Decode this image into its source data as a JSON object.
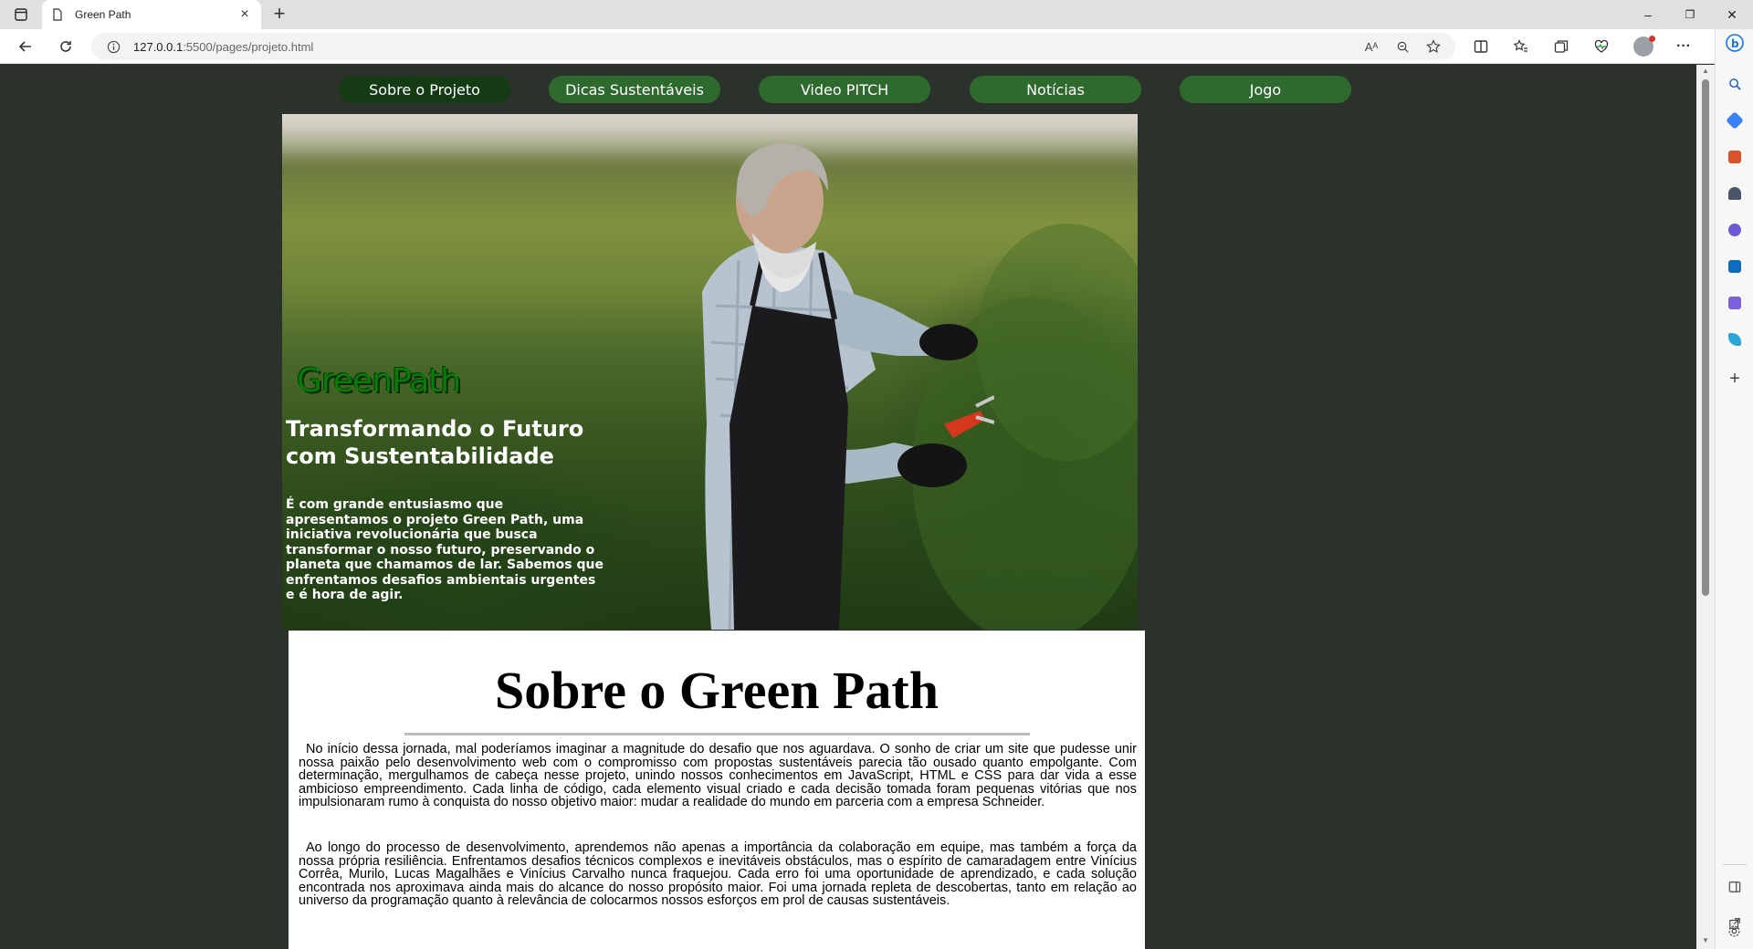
{
  "browser": {
    "tab_title": "Green Path",
    "tab_close": "×",
    "new_tab": "+",
    "url_host": "127.0.0.1",
    "url_path": ":5500/pages/projeto.html",
    "read_aloud": "Aᴬ",
    "more": "···",
    "win_minimize": "–",
    "win_restore": "❐",
    "win_close": "✕"
  },
  "nav": {
    "items": [
      {
        "label": "Sobre o Projeto",
        "active": true
      },
      {
        "label": "Dicas Sustentáveis",
        "active": false
      },
      {
        "label": "Video PITCH",
        "active": false
      },
      {
        "label": "Notícias",
        "active": false
      },
      {
        "label": "Jogo",
        "active": false
      }
    ]
  },
  "hero": {
    "brand": "GreenPath",
    "title": "Transformando o Futuro com Sustentabilidade",
    "text": "É com grande entusiasmo que apresentamos o projeto Green Path, uma iniciativa revolucionária que busca transformar o nosso futuro, preservando o planeta que chamamos de lar. Sabemos que enfrentamos desafios ambientais urgentes e é hora de agir."
  },
  "about": {
    "title": "Sobre o Green Path",
    "paragraphs": [
      "No início dessa jornada, mal poderíamos imaginar a magnitude do desafio que nos aguardava. O sonho de criar um site que pudesse unir nossa paixão pelo desenvolvimento web com o compromisso com propostas sustentáveis parecia tão ousado quanto empolgante. Com determinação, mergulhamos de cabeça nesse projeto, unindo nossos conhecimentos em JavaScript, HTML e CSS para dar vida a esse ambicioso empreendimento. Cada linha de código, cada elemento visual criado e cada decisão tomada foram pequenas vitórias que nos impulsionaram rumo à conquista do nosso objetivo maior: mudar a realidade do mundo em parceria com a empresa Schneider.",
      "Ao longo do processo de desenvolvimento, aprendemos não apenas a importância da colaboração em equipe, mas também a força da nossa própria resiliência. Enfrentamos desafios técnicos complexos e inevitáveis obstáculos, mas o espírito de camaradagem entre Vinícius Corrêa, Murilo, Lucas Magalhães e Vinícius Carvalho nunca fraquejou. Cada erro foi uma oportunidade de aprendizado, e cada solução encontrada nos aproximava ainda mais do alcance do nosso propósito maior. Foi uma jornada repleta de descobertas, tanto em relação ao universo da programação quanto à relevância de colocarmos nossos esforços em prol de causas sustentáveis."
    ]
  },
  "icons": {
    "sidebar": [
      "search-icon",
      "tag-icon",
      "briefcase-icon",
      "chess-icon",
      "copilot-icon",
      "outlook-icon",
      "designer-icon",
      "send-icon",
      "add-icon",
      "split-icon",
      "external-icon",
      "settings-icon"
    ]
  },
  "colors": {
    "page_bg": "#2b322b",
    "nav_button": "#2e6a2e",
    "nav_active": "#143b14",
    "brand_green": "#0a7a0a"
  }
}
